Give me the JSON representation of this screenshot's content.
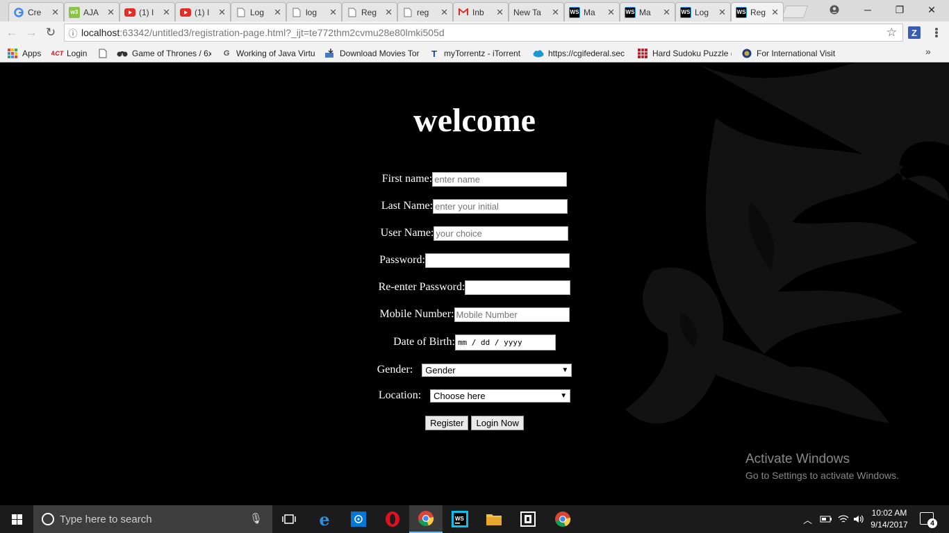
{
  "browser": {
    "tabs": [
      {
        "title": "Cre",
        "icon": "google-icon",
        "active": false
      },
      {
        "title": "AJA",
        "icon": "w3-icon",
        "active": false
      },
      {
        "title": "(1) I",
        "icon": "youtube-icon",
        "active": false
      },
      {
        "title": "(1) I",
        "icon": "youtube-icon",
        "active": false
      },
      {
        "title": "Log",
        "icon": "page-icon",
        "active": false
      },
      {
        "title": "log",
        "icon": "page-icon",
        "active": false
      },
      {
        "title": "Reg",
        "icon": "page-icon",
        "active": false
      },
      {
        "title": "reg",
        "icon": "page-icon",
        "active": false
      },
      {
        "title": "Inb",
        "icon": "gmail-icon",
        "active": false
      },
      {
        "title": "New Ta",
        "icon": "",
        "active": false
      },
      {
        "title": "Ma",
        "icon": "webstorm-icon",
        "active": false
      },
      {
        "title": "Ma",
        "icon": "webstorm-icon",
        "active": false
      },
      {
        "title": "Log",
        "icon": "webstorm-icon",
        "active": false
      },
      {
        "title": "Reg",
        "icon": "webstorm-icon",
        "active": true
      }
    ],
    "address": {
      "host": "localhost",
      "path": ":63342/untitled3/registration-page.html?_ijt=te772thm2cvmu28e80lmki505d"
    },
    "extension_label": "Z",
    "bookmarks": [
      {
        "label": "Apps",
        "icon": "apps-grid-icon"
      },
      {
        "label": "Login",
        "icon": "act-icon"
      },
      {
        "label": "",
        "icon": "page-icon"
      },
      {
        "label": "Game of Thrones / 6x",
        "icon": "binoculars-icon"
      },
      {
        "label": "Working of Java Virtu",
        "icon": "g-icon"
      },
      {
        "label": "Download Movies Tor",
        "icon": "download-icon"
      },
      {
        "label": "myTorrentz - iTorrent",
        "icon": "torrent-icon"
      },
      {
        "label": "https://cgifederal.sec",
        "icon": "cloud-icon"
      },
      {
        "label": "Hard Sudoku Puzzle (",
        "icon": "sudoku-icon"
      },
      {
        "label": "For International Visit",
        "icon": "seal-icon"
      }
    ]
  },
  "form": {
    "title": "welcome",
    "first_name": {
      "label": "First name:",
      "placeholder": "enter name"
    },
    "last_name": {
      "label": "Last Name:",
      "placeholder": "enter your initial"
    },
    "user_name": {
      "label": "User Name:",
      "placeholder": "your choice"
    },
    "password": {
      "label": "Password:"
    },
    "reenter_password": {
      "label": "Re-enter Password:"
    },
    "mobile": {
      "label": "Mobile Number:",
      "placeholder": "Mobile Number"
    },
    "dob": {
      "label": "Date of Birth:",
      "value": "mm / dd / yyyy"
    },
    "gender": {
      "label": "Gender:",
      "selected": "Gender"
    },
    "location": {
      "label": "Location:",
      "selected": "Choose here"
    },
    "register_button": "Register",
    "login_button": "Login Now"
  },
  "watermark": {
    "line1": "Activate Windows",
    "line2": "Go to Settings to activate Windows."
  },
  "taskbar": {
    "search_placeholder": "Type here to search",
    "apps": [
      "task-view-icon",
      "edge-icon",
      "store-icon",
      "opera-icon",
      "chrome-icon",
      "webstorm-icon",
      "file-explorer-icon",
      "app-icon",
      "chrome-icon"
    ],
    "time": "10:02 AM",
    "date": "9/14/2017",
    "notifications": "4"
  }
}
